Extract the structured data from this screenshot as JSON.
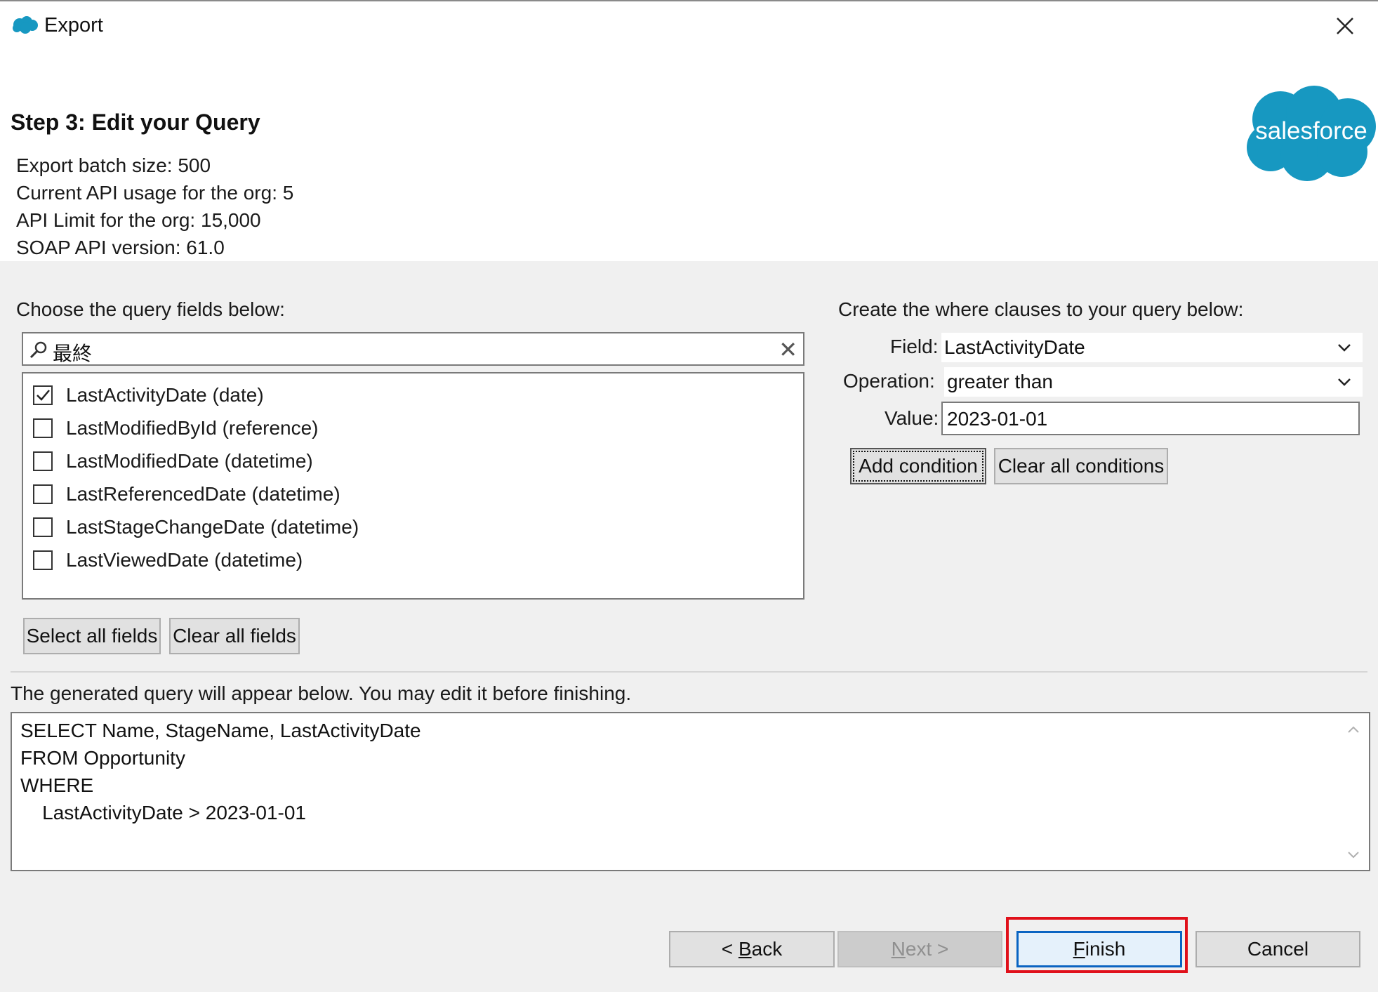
{
  "window": {
    "title": "Export",
    "close_icon": "close-icon",
    "app_icon": "salesforce-cloud-icon"
  },
  "header": {
    "step_title": "Step 3: Edit your Query",
    "info_lines": [
      "Export batch size: 500",
      "Current API usage for the org: 5",
      "API Limit for the org: 15,000",
      "SOAP API version: 61.0"
    ],
    "logo_text": "salesforce",
    "logo_color": "#1798c1"
  },
  "fields_panel": {
    "label": "Choose the query fields below:",
    "search_value": "最終",
    "search_icon": "search-icon",
    "clear_icon": "clear-icon",
    "items": [
      {
        "label": "LastActivityDate (date)",
        "checked": true
      },
      {
        "label": "LastModifiedById (reference)",
        "checked": false
      },
      {
        "label": "LastModifiedDate (datetime)",
        "checked": false
      },
      {
        "label": "LastReferencedDate (datetime)",
        "checked": false
      },
      {
        "label": "LastStageChangeDate (datetime)",
        "checked": false
      },
      {
        "label": "LastViewedDate (datetime)",
        "checked": false
      }
    ],
    "select_all_label": "Select all fields",
    "clear_all_label": "Clear all fields"
  },
  "where_panel": {
    "label": "Create the where clauses to your query below:",
    "field_label": "Field:",
    "field_value": "LastActivityDate",
    "operation_label": "Operation:",
    "operation_value": "greater than",
    "value_label": "Value:",
    "value_value": "2023-01-01",
    "add_condition_label": "Add condition",
    "clear_conditions_label": "Clear all conditions"
  },
  "query_panel": {
    "label": "The generated query will appear below.  You may edit it before finishing.",
    "lines": [
      "SELECT Name, StageName, LastActivityDate",
      "FROM Opportunity",
      "WHERE",
      "    LastActivityDate > 2023-01-01"
    ]
  },
  "footer": {
    "back_prefix": "< ",
    "back_mnemonic": "B",
    "back_rest": "ack",
    "next_mnemonic": "N",
    "next_rest": "ext >",
    "finish_mnemonic": "F",
    "finish_rest": "inish",
    "cancel_label": "Cancel",
    "highlight_color": "#e0101a"
  }
}
